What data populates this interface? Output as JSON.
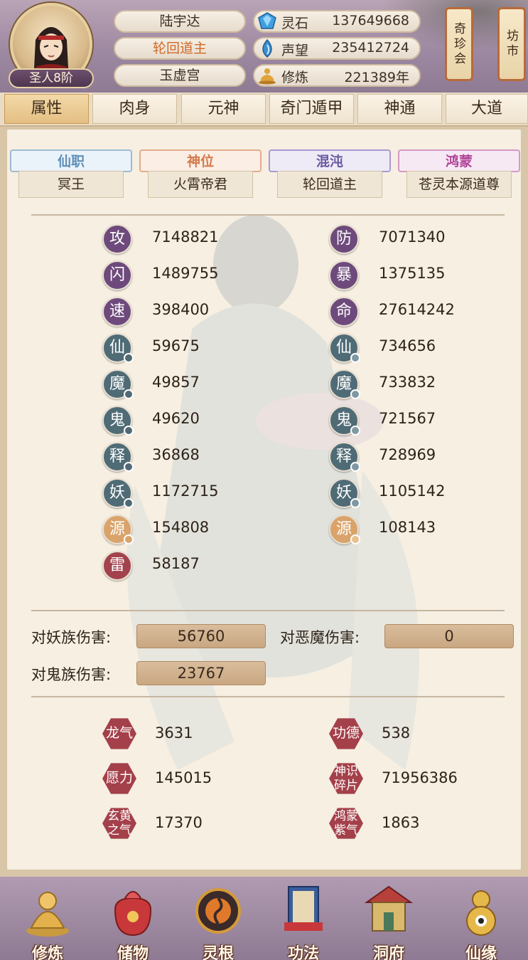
{
  "player": {
    "name": "陆宇达",
    "title": "轮回道主",
    "sect": "玉虚宫",
    "rank": "圣人8阶"
  },
  "resources": [
    {
      "icon": "spirit-stone-icon",
      "label": "灵石",
      "value": "137649668"
    },
    {
      "icon": "reputation-icon",
      "label": "声望",
      "value": "235412724"
    },
    {
      "icon": "meditation-icon",
      "label": "修炼",
      "value": "221389年"
    }
  ],
  "side_buttons": {
    "treasure": "奇珍会",
    "market": "坊市"
  },
  "tabs": [
    "属性",
    "肉身",
    "元神",
    "奇门遁甲",
    "神通",
    "大道"
  ],
  "titles": [
    {
      "header": "仙职",
      "value": "冥王",
      "color": "#5f8fb6"
    },
    {
      "header": "神位",
      "value": "火霄帝君",
      "color": "#d47a4c"
    },
    {
      "header": "混沌",
      "value": "轮回道主",
      "color": "#6b5aa0"
    },
    {
      "header": "鸿蒙",
      "value": "苍灵本源道尊",
      "color": "#b0469a"
    }
  ],
  "stats_left": [
    {
      "label": "攻",
      "value": "7148821",
      "color": "#6e4a7c"
    },
    {
      "label": "闪",
      "value": "1489755",
      "color": "#6e4a7c"
    },
    {
      "label": "速",
      "value": "398400",
      "color": "#6e4a7c"
    },
    {
      "label": "仙",
      "value": "59675",
      "color": "#4f6b76"
    },
    {
      "label": "魔",
      "value": "49857",
      "color": "#4f6b76"
    },
    {
      "label": "鬼",
      "value": "49620",
      "color": "#4f6b76"
    },
    {
      "label": "释",
      "value": "36868",
      "color": "#4f6b76"
    },
    {
      "label": "妖",
      "value": "1172715",
      "color": "#4f6b76"
    },
    {
      "label": "源",
      "value": "154808",
      "color": "#d9a36a"
    },
    {
      "label": "雷",
      "value": "58187",
      "color": "#a2424c"
    }
  ],
  "stats_right": [
    {
      "label": "防",
      "value": "7071340",
      "color": "#6e4a7c"
    },
    {
      "label": "暴",
      "value": "1375135",
      "color": "#6e4a7c"
    },
    {
      "label": "命",
      "value": "27614242",
      "color": "#6e4a7c"
    },
    {
      "label": "仙",
      "value": "734656",
      "color": "#4f6b76"
    },
    {
      "label": "魔",
      "value": "733832",
      "color": "#4f6b76"
    },
    {
      "label": "鬼",
      "value": "721567",
      "color": "#4f6b76"
    },
    {
      "label": "释",
      "value": "728969",
      "color": "#4f6b76"
    },
    {
      "label": "妖",
      "value": "1105142",
      "color": "#4f6b76"
    },
    {
      "label": "源",
      "value": "108143",
      "color": "#d9a36a"
    }
  ],
  "damage": {
    "yao_label": "对妖族伤害:",
    "yao_value": "56760",
    "demon_label": "对恶魔伤害:",
    "demon_value": "0",
    "ghost_label": "对鬼族伤害:",
    "ghost_value": "23767"
  },
  "extras": [
    {
      "label": "龙气",
      "value": "3631"
    },
    {
      "label": "功德",
      "value": "538"
    },
    {
      "label": "愿力",
      "value": "145015"
    },
    {
      "label": "神识碎片",
      "value": "71956386"
    },
    {
      "label": "玄黄之气",
      "value": "17370"
    },
    {
      "label": "鸿蒙紫气",
      "value": "1863"
    }
  ],
  "bottom_nav": [
    "修炼",
    "储物",
    "灵根",
    "功法",
    "洞府",
    "仙缘"
  ]
}
